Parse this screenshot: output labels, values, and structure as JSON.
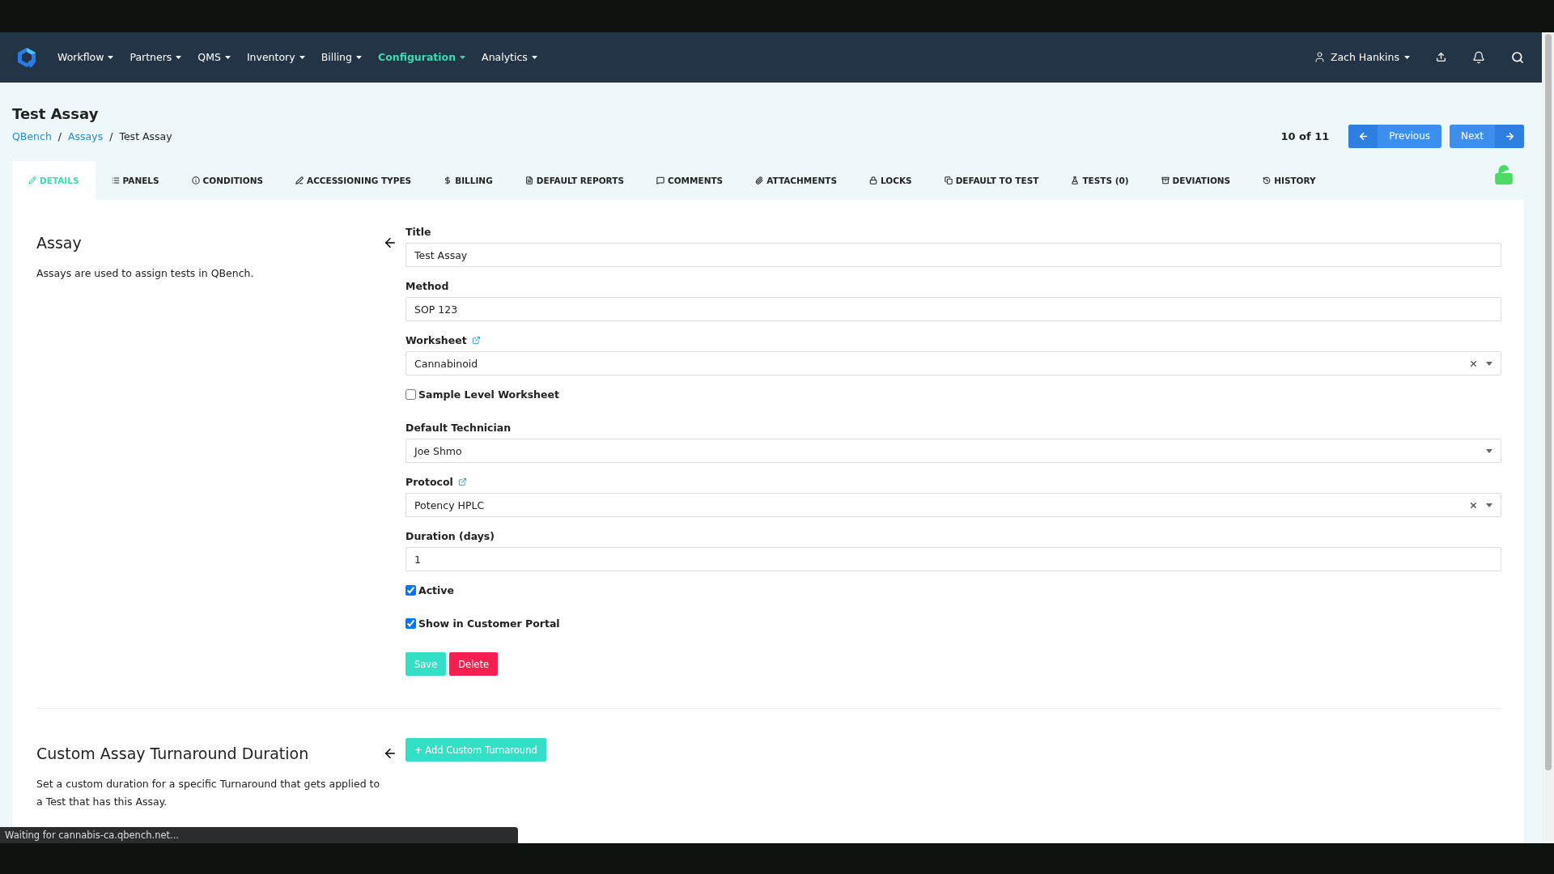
{
  "nav": {
    "items": [
      {
        "label": "Workflow",
        "selected": false
      },
      {
        "label": "Partners",
        "selected": false
      },
      {
        "label": "QMS",
        "selected": false
      },
      {
        "label": "Inventory",
        "selected": false
      },
      {
        "label": "Billing",
        "selected": false
      },
      {
        "label": "Configuration",
        "selected": true
      },
      {
        "label": "Analytics",
        "selected": false
      }
    ],
    "user": "Zach Hankins"
  },
  "page": {
    "title": "Test Assay",
    "breadcrumb": [
      {
        "label": "QBench",
        "link": true
      },
      {
        "label": "Assays",
        "link": true
      },
      {
        "label": "Test Assay",
        "link": false
      }
    ],
    "separator": "/",
    "position": "10 of 11",
    "previous": "Previous",
    "next": "Next"
  },
  "tabs": [
    {
      "label": "DETAILS",
      "selected": true
    },
    {
      "label": "PANELS",
      "selected": false
    },
    {
      "label": "CONDITIONS",
      "selected": false
    },
    {
      "label": "ACCESSIONING TYPES",
      "selected": false
    },
    {
      "label": "BILLING",
      "selected": false
    },
    {
      "label": "DEFAULT REPORTS",
      "selected": false
    },
    {
      "label": "COMMENTS",
      "selected": false
    },
    {
      "label": "ATTACHMENTS",
      "selected": false
    },
    {
      "label": "LOCKS",
      "selected": false
    },
    {
      "label": "DEFAULT TO TEST",
      "selected": false
    },
    {
      "label": "TESTS (0)",
      "selected": false
    },
    {
      "label": "DEVIATIONS",
      "selected": false
    },
    {
      "label": "HISTORY",
      "selected": false
    }
  ],
  "locked": false,
  "assay_section": {
    "heading": "Assay",
    "description": "Assays are used to assign tests in QBench.",
    "fields": [
      {
        "kind": "text",
        "label": "Title",
        "value": "Test Assay"
      },
      {
        "kind": "text",
        "label": "Method",
        "value": "SOP 123"
      },
      {
        "kind": "select",
        "label": "Worksheet",
        "value": "Cannabinoid",
        "link": true,
        "clearable": true
      },
      {
        "kind": "checkbox",
        "label": "Sample Level Worksheet",
        "checked": false
      },
      {
        "kind": "select",
        "label": "Default Technician",
        "value": "Joe Shmo",
        "link": false,
        "clearable": false
      },
      {
        "kind": "select",
        "label": "Protocol",
        "value": "Potency HPLC",
        "link": true,
        "clearable": true
      },
      {
        "kind": "text",
        "label": "Duration (days)",
        "value": "1"
      },
      {
        "kind": "checkbox",
        "label": "Active",
        "checked": true
      },
      {
        "kind": "checkbox",
        "label": "Show in Customer Portal",
        "checked": true
      }
    ],
    "buttons": [
      {
        "kind": "save",
        "label": "Save"
      },
      {
        "kind": "delete",
        "label": "Delete"
      }
    ]
  },
  "turnaround_section": {
    "heading": "Custom Assay Turnaround Duration",
    "description": "Set a custom duration for a specific Turnaround that gets applied to a Test that has this Assay.",
    "button": "+ Add Custom Turnaround"
  },
  "status_bar": "Waiting for cannabis-ca.qbench.net..."
}
